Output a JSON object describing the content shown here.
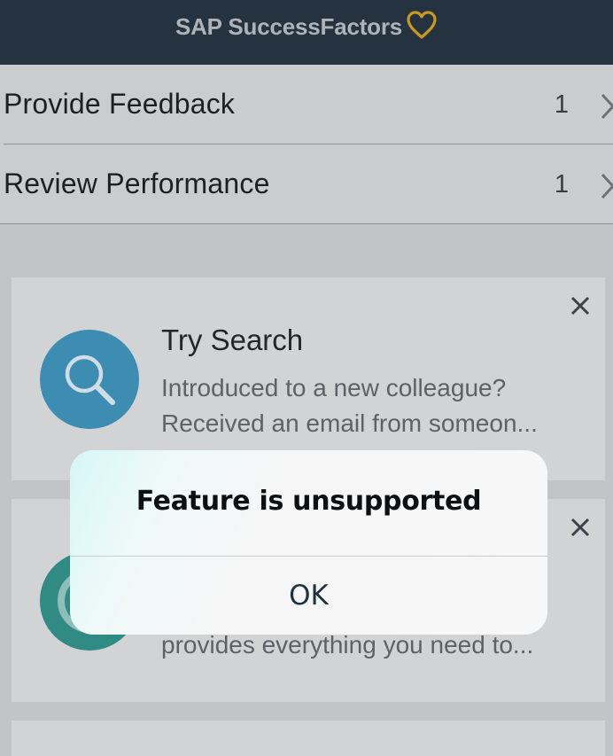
{
  "header": {
    "title": "SAP SuccessFactors",
    "icon": "heart-icon",
    "background": "#253240",
    "accent": "#c99a1f"
  },
  "todos": [
    {
      "label": "Provide Feedback",
      "count": "1",
      "icon": "chevron-right-icon"
    },
    {
      "label": "Review Performance",
      "count": "1",
      "icon": "chevron-right-icon"
    }
  ],
  "cards": [
    {
      "title": "Try Search",
      "text_line1": "Introduced to a new colleague?",
      "text_line2": "Received an email from someon...",
      "icon": "search-icon",
      "icon_color": "#3d8db3",
      "close_icon": "close-icon"
    },
    {
      "title": "",
      "text_line2": "provides everything you need to...",
      "icon": "ring-icon",
      "icon_color": "#2f8b84",
      "close_icon": "close-icon"
    }
  ],
  "alert": {
    "title": "Feature is unsupported",
    "ok_label": "OK"
  }
}
